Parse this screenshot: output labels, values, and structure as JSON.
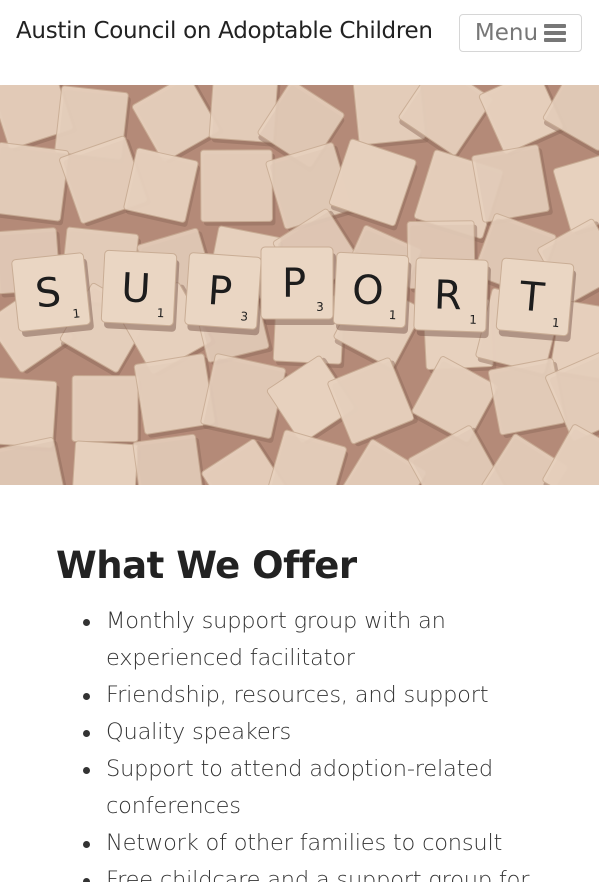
{
  "header": {
    "site_title": "Austin Council on Adoptable Children",
    "menu_label": "Menu",
    "menu_icon": "hamburger-icon"
  },
  "hero": {
    "image_subject": "scrabble-tiles",
    "letters": [
      {
        "char": "S",
        "score": "1"
      },
      {
        "char": "U",
        "score": "1"
      },
      {
        "char": "P",
        "score": "3"
      },
      {
        "char": "P",
        "score": "3"
      },
      {
        "char": "O",
        "score": "1"
      },
      {
        "char": "R",
        "score": "1"
      },
      {
        "char": "T",
        "score": "1"
      }
    ]
  },
  "main": {
    "heading": "What We Offer",
    "offers": [
      "Monthly support group with an experienced facilitator",
      "Friendship, resources, and support",
      "Quality speakers",
      "Support to attend adoption-related conferences",
      "Network of other families to consult",
      "Free childcare and a support group for"
    ]
  },
  "colors": {
    "text": "#222222",
    "menu_text": "#777777",
    "tile": "#e8d2bf",
    "background_table": "#b48a78"
  }
}
